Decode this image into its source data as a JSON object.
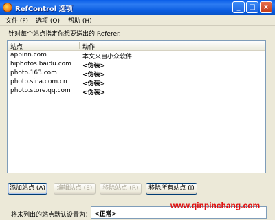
{
  "window": {
    "title": "RefControl 选项",
    "minimize_label": "_",
    "maximize_label": "□",
    "close_label": "×"
  },
  "menu": [
    {
      "label": "文件 (F)"
    },
    {
      "label": "选项 (O)"
    },
    {
      "label": "帮助 (H)"
    }
  ],
  "instruction": "针对每个站点指定你想要送出的 Referer.",
  "table": {
    "columns": [
      "站点",
      "动作"
    ],
    "rows": [
      {
        "site": "appinn.com",
        "action": "本文来自小众软件",
        "bold": false
      },
      {
        "site": "hiphotos.baidu.com",
        "action": "<伪装>",
        "bold": true
      },
      {
        "site": "photo.163.com",
        "action": "<伪装>",
        "bold": true
      },
      {
        "site": "photo.sina.com.cn",
        "action": "<伪装>",
        "bold": true
      },
      {
        "site": "photo.store.qq.com",
        "action": "<伪装>",
        "bold": true
      }
    ]
  },
  "buttons": {
    "add": "添加站点 (A)",
    "edit": "编辑站点 (E)",
    "remove": "移除站点 (R)",
    "remove_all": "移除所有站点 (I)"
  },
  "default_setting": {
    "label": "将未列出的站点默认设置为：",
    "value": "<正常>"
  },
  "watermark": "www.qinpinchang.com",
  "colors": {
    "titlebar": "#0a5ee8",
    "watermark": "#e01010",
    "window_bg": "#ece9d8"
  }
}
